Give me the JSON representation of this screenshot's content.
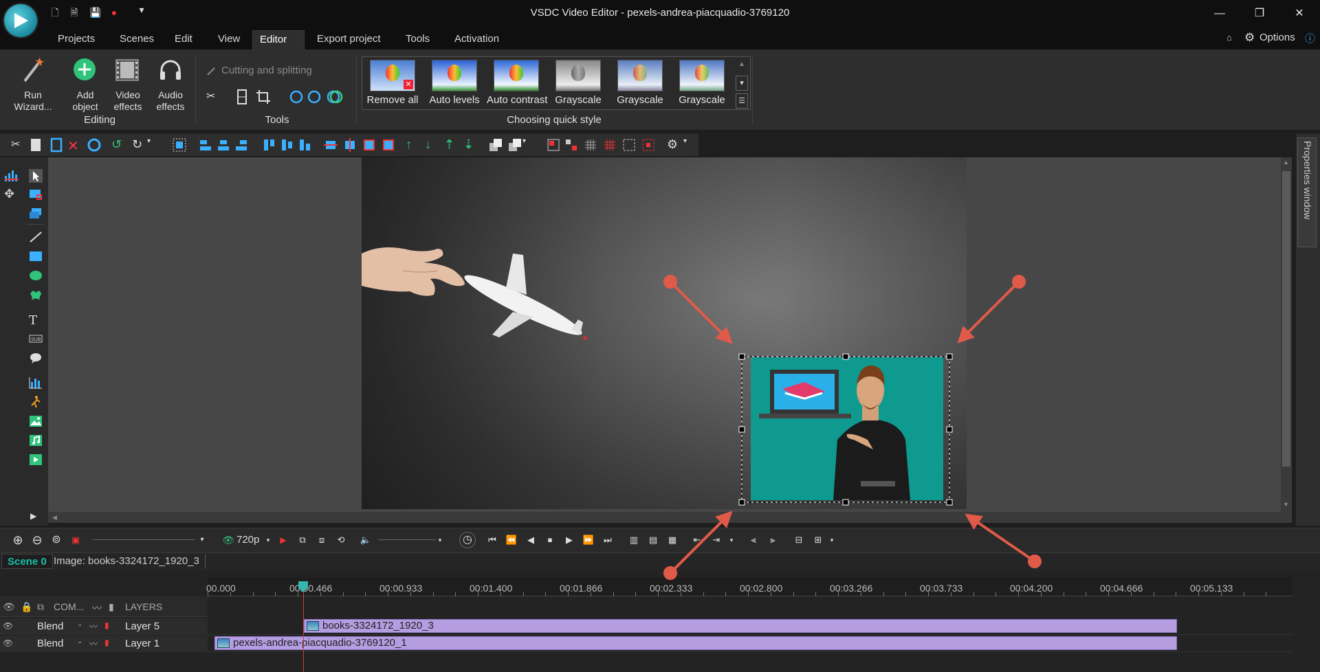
{
  "window": {
    "title": "VSDC Video Editor - pexels-andrea-piacquadio-3769120"
  },
  "title_controls": {
    "minimize": "—",
    "restore": "❐",
    "close": "✕"
  },
  "menu": {
    "items": [
      "Projects",
      "Scenes",
      "Edit",
      "View",
      "Editor",
      "Export project",
      "Tools",
      "Activation"
    ],
    "active": "Editor",
    "options_label": "Options"
  },
  "ribbon": {
    "editing": {
      "run_wizard": "Run\nWizard...",
      "add_object": "Add\nobject",
      "video_effects": "Video\neffects",
      "audio_effects": "Audio\neffects",
      "group_label": "Editing"
    },
    "tools": {
      "cutting_label": "Cutting and splitting",
      "group_label": "Tools"
    },
    "quick_style": {
      "items": [
        "Remove all",
        "Auto levels",
        "Auto contrast",
        "Grayscale",
        "Grayscale",
        "Grayscale"
      ],
      "group_label": "Choosing quick style"
    }
  },
  "properties_panel": {
    "label": "Properties window"
  },
  "playback": {
    "resolution": "720p"
  },
  "scene_tabs": {
    "scene": "Scene 0",
    "object": "Image: books-3324172_1920_3"
  },
  "timeline": {
    "headers": {
      "com": "COM...",
      "layers": "LAYERS"
    },
    "ruler_ticks": [
      "00.000",
      "00:00.466",
      "00:00.933",
      "00:01.400",
      "00:01.866",
      "00:02.333",
      "00:02.800",
      "00:03.266",
      "00:03.733",
      "00:04.200",
      "00:04.666",
      "00:05.133"
    ],
    "tracks": [
      {
        "blend": "Blend",
        "layer": "Layer 5",
        "clip": "books-3324172_1920_3"
      },
      {
        "blend": "Blend",
        "layer": "Layer 1",
        "clip": "pexels-andrea-piacquadio-3769120_1"
      }
    ]
  },
  "colors": {
    "accent_teal": "#16c0a8",
    "clip_purple": "#b49de0",
    "arrow_red": "#e05a4a",
    "overlay_bg": "#0e9a8e"
  }
}
